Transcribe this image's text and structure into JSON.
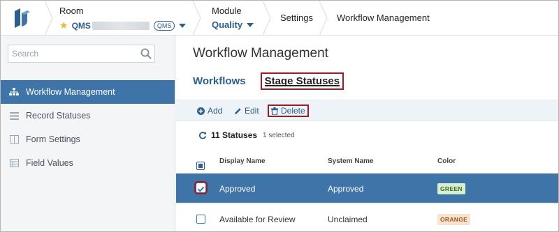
{
  "header": {
    "room_label": "Room",
    "room_name": "QMS",
    "room_pill": "QMS",
    "module_label": "Module",
    "module_name": "Quality",
    "breadcrumb_settings": "Settings",
    "breadcrumb_current": "Workflow Management"
  },
  "sidebar": {
    "search_placeholder": "Search",
    "items": [
      {
        "label": "Workflow Management",
        "icon": "sitemap-icon",
        "active": true
      },
      {
        "label": "Record Statuses",
        "icon": "list-icon",
        "active": false
      },
      {
        "label": "Form Settings",
        "icon": "columns-icon",
        "active": false
      },
      {
        "label": "Field Values",
        "icon": "table-icon",
        "active": false
      }
    ]
  },
  "main": {
    "title": "Workflow Management",
    "tabs": [
      {
        "label": "Workflows",
        "active": false
      },
      {
        "label": "Stage Statuses",
        "active": true
      }
    ],
    "toolbar": {
      "add_label": "Add",
      "edit_label": "Edit",
      "delete_label": "Delete"
    },
    "status_count": "11 Statuses",
    "selected_text": "1 selected",
    "columns": {
      "display_name": "Display Name",
      "system_name": "System Name",
      "color": "Color"
    },
    "rows": [
      {
        "display_name": "Approved",
        "system_name": "Approved",
        "color": "GREEN",
        "selected": true
      },
      {
        "display_name": "Available for Review",
        "system_name": "Unclaimed",
        "color": "ORANGE",
        "selected": false
      }
    ]
  },
  "colors": {
    "accent": "#3e74a8",
    "link": "#2a5f8f",
    "highlight_box": "#9e1b26",
    "star": "#f3b531",
    "badge_green_bg": "#d9eecf",
    "badge_orange_bg": "#f8e3cf"
  }
}
